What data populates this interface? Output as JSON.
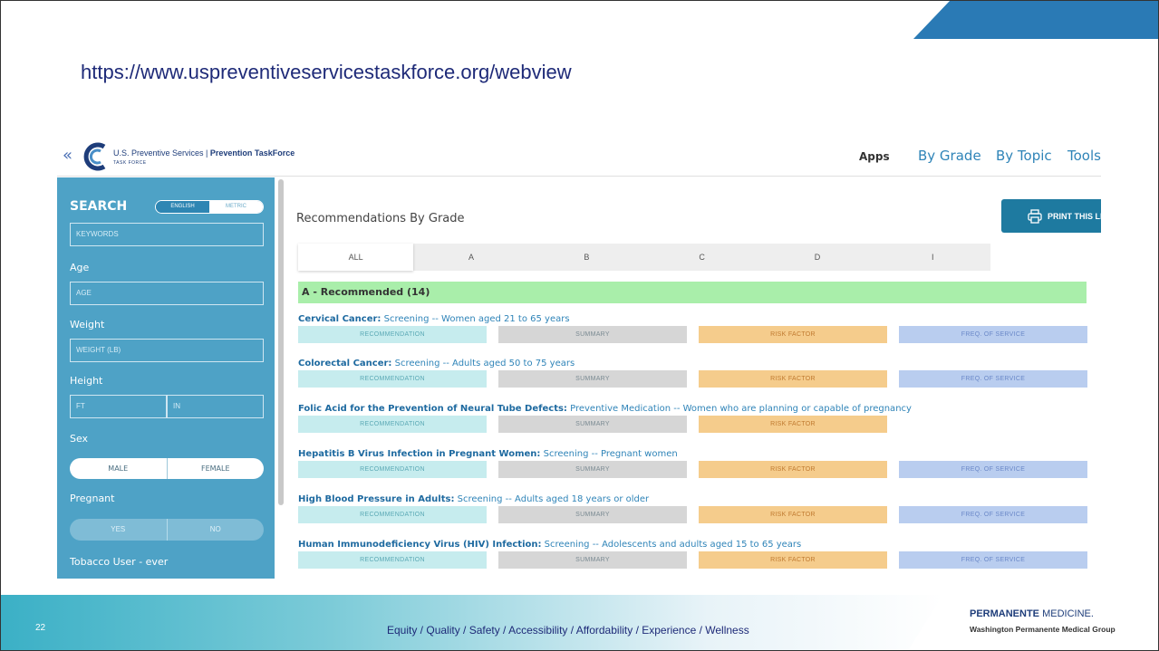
{
  "url": "https://www.uspreventiveservicestaskforce.org/webview",
  "app": {
    "logo_name": "U.S. Preventive Services",
    "logo_brand": "Prevention TaskForce",
    "logo_sub": "TASK FORCE"
  },
  "nav": {
    "apps": "Apps",
    "by_grade": "By Grade",
    "by_topic": "By Topic",
    "tools": "Tools"
  },
  "sidebar": {
    "title": "SEARCH",
    "unit_english": "ENGLISH",
    "unit_metric": "METRIC",
    "keyword_placeholder": "KEYWORDS",
    "age_label": "Age",
    "age_placeholder": "AGE",
    "weight_label": "Weight",
    "weight_placeholder": "WEIGHT (LB)",
    "height_label": "Height",
    "height_ft": "FT",
    "height_in": "IN",
    "sex_label": "Sex",
    "sex_male": "MALE",
    "sex_female": "FEMALE",
    "pregnant_label": "Pregnant",
    "pregnant_yes": "YES",
    "pregnant_no": "NO",
    "tobacco_label": "Tobacco User - ever"
  },
  "main": {
    "title": "Recommendations By Grade",
    "print_label": "PRINT THIS LIST",
    "tabs": [
      "ALL",
      "A",
      "B",
      "C",
      "D",
      "I"
    ],
    "grade_header": "A - Recommended (14)",
    "buttons": {
      "recommendation": "RECOMMENDATION",
      "summary": "SUMMARY",
      "risk": "RISK FACTOR",
      "freq": "FREQ. OF SERVICE"
    },
    "recs": [
      {
        "name": "Cervical Cancer:",
        "desc": " Screening -- Women aged 21 to 65 years"
      },
      {
        "name": "Colorectal Cancer:",
        "desc": " Screening -- Adults aged 50 to 75 years"
      },
      {
        "name": "Folic Acid for the Prevention of Neural Tube Defects:",
        "desc": " Preventive Medication -- Women who are planning or capable of pregnancy"
      },
      {
        "name": "Hepatitis B Virus Infection in Pregnant Women:",
        "desc": " Screening -- Pregnant women"
      },
      {
        "name": "High Blood Pressure in Adults:",
        "desc": " Screening -- Adults aged 18 years or older"
      },
      {
        "name": "Human Immunodeficiency Virus (HIV) Infection:",
        "desc": " Screening -- Adolescents and adults aged 15 to 65 years"
      }
    ]
  },
  "footer": {
    "slide_number": "22",
    "tagline": "Equity / Quality / Safety / Accessibility / Affordability / Experience / Wellness",
    "brand_bold": "PERMANENTE",
    "brand_light": " MEDICINE.",
    "brand_sub": "Washington Permanente Medical Group"
  },
  "colors": {
    "accent_blue": "#1e7aa0",
    "sidebar": "#4ea2c6",
    "grade_green": "#a9eeaa",
    "footer_teal": "#3bb0c6"
  }
}
